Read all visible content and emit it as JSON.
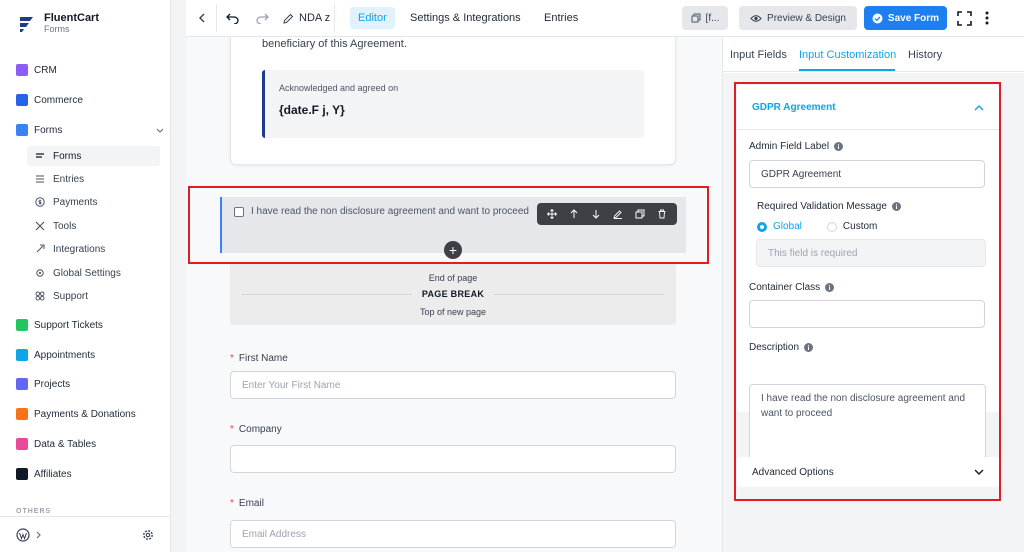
{
  "brand": {
    "name": "FluentCart",
    "sub": "Forms"
  },
  "sidebar": {
    "items": [
      {
        "label": "CRM",
        "color": "#8b5cf6"
      },
      {
        "label": "Commerce",
        "color": "#2563eb"
      },
      {
        "label": "Forms",
        "color": "#3b82f6"
      }
    ],
    "sub_items": [
      {
        "label": "Forms"
      },
      {
        "label": "Entries"
      },
      {
        "label": "Payments"
      },
      {
        "label": "Tools"
      },
      {
        "label": "Integrations"
      },
      {
        "label": "Global Settings"
      },
      {
        "label": "Support"
      }
    ],
    "more_items": [
      {
        "label": "Support Tickets",
        "color": "#22c55e"
      },
      {
        "label": "Appointments",
        "color": "#0ea5e9"
      },
      {
        "label": "Projects",
        "color": "#6366f1"
      },
      {
        "label": "Payments & Donations",
        "color": "#f97316"
      },
      {
        "label": "Data & Tables",
        "color": "#ec4899"
      },
      {
        "label": "Affiliates",
        "color": "#111827"
      }
    ],
    "others_label": "OTHERS"
  },
  "topbar": {
    "form_name": "NDA z",
    "tabs": [
      {
        "label": "Editor"
      },
      {
        "label": "Settings & Integrations"
      },
      {
        "label": "Entries"
      }
    ],
    "shortcode_label": "[f...",
    "preview_label": "Preview & Design",
    "save_label": "Save Form"
  },
  "canvas": {
    "ack_text": "beneficiary of this Agreement.",
    "ack_label": "Acknowledged and agreed on",
    "ack_date": "{date.F j, Y}",
    "gdpr_text": "I have read the non disclosure agreement and want to proceed",
    "page_break": {
      "end": "End of page",
      "title": "PAGE BREAK",
      "top": "Top of new page"
    },
    "fields": {
      "first_name": {
        "label": "First Name",
        "placeholder": "Enter Your First Name"
      },
      "company": {
        "label": "Company",
        "placeholder": ""
      },
      "email": {
        "label": "Email",
        "placeholder": "Email Address"
      }
    }
  },
  "panel": {
    "tabs": [
      {
        "label": "Input Fields"
      },
      {
        "label": "Input Customization"
      },
      {
        "label": "History"
      }
    ],
    "section_title": "GDPR Agreement",
    "admin_label": "Admin Field Label",
    "admin_value": "GDPR Agreement",
    "validation_label": "Required Validation Message",
    "radio_global": "Global",
    "radio_custom": "Custom",
    "validation_placeholder": "This field is required",
    "container_label": "Container Class",
    "description_label": "Description",
    "description_value": "I have read the non disclosure agreement and want to proceed",
    "advanced_label": "Advanced Options"
  },
  "colors": {
    "accent": "#0ea5e9",
    "primary_button": "#1d7ff0",
    "highlight": "#e11d24"
  }
}
